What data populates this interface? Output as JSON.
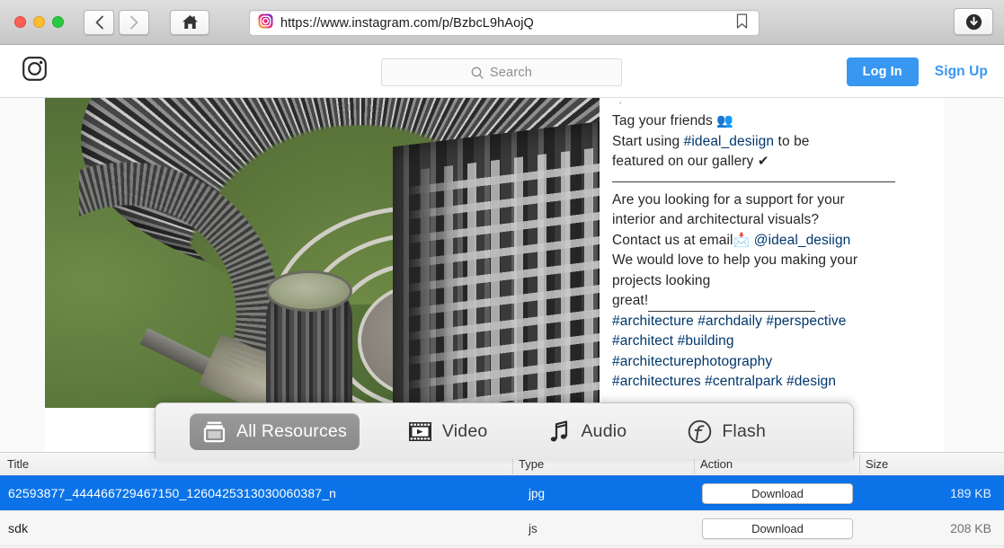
{
  "browser": {
    "back_label": "Back",
    "forward_label": "Forward",
    "home_label": "Home",
    "url": "https://www.instagram.com/p/BzbcL9hAojQ",
    "bookmark_label": "Bookmark",
    "download_label": "Download",
    "traffic_lights": [
      "close",
      "minimize",
      "maximize"
    ]
  },
  "instagram": {
    "logo_label": "Instagram",
    "search_placeholder": "Search",
    "search_value": "",
    "login_label": "Log In",
    "signup_label": "Sign Up",
    "accent_color": "#3897f0"
  },
  "post": {
    "image_alt": "Aerial photo of a curved monumental residential complex with circular courtyard and lawn",
    "caption": {
      "line1": "Tag your friends",
      "line1_emoji": "👥",
      "line2_pre": "Start using ",
      "line2_tag": "#ideal_desiign",
      "line2_post": " to be",
      "line3": "featured on our gallery",
      "line3_emoji": "✔",
      "line4": "Are you looking for a support for your",
      "line5": "interior and architectural visuals?",
      "line6_pre": "Contact us at email",
      "line6_emoji": "📩",
      "line6_mention": "@ideal_desiign",
      "line7": "We would love to help you making your",
      "line8": "projects looking",
      "line9": "great!",
      "hashtags_line1": "#architecture #archdaily #perspective",
      "hashtags_line2": "#architect #building",
      "hashtags_line3": "#architecturephotography",
      "hashtags_line4": "#architectures #centralpark #design",
      "link_color": "#00376b"
    }
  },
  "filter_bar": {
    "items": [
      {
        "label": "All Resources",
        "icon": "all-resources-icon",
        "active": true
      },
      {
        "label": "Video",
        "icon": "video-icon",
        "active": false
      },
      {
        "label": "Audio",
        "icon": "audio-icon",
        "active": false
      },
      {
        "label": "Flash",
        "icon": "flash-icon",
        "active": false
      }
    ]
  },
  "resource_table": {
    "columns": [
      "Title",
      "Type",
      "Action",
      "Size"
    ],
    "rows": [
      {
        "title": "62593877_444466729467150_1260425313030060387_n",
        "type": "jpg",
        "action": "Download",
        "size": "189 KB",
        "selected": true
      },
      {
        "title": "sdk",
        "type": "js",
        "action": "Download",
        "size": "208 KB",
        "selected": false
      }
    ],
    "selection_color": "#0b72e7"
  }
}
